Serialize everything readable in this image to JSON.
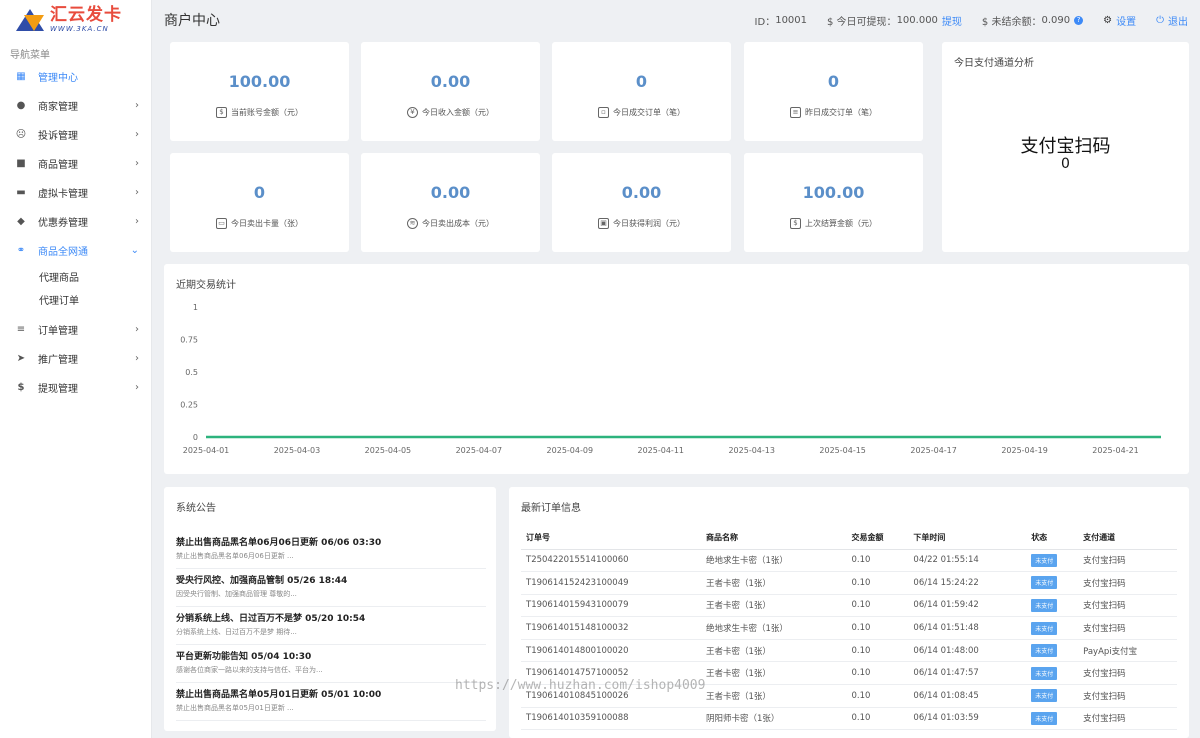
{
  "logo": {
    "text_cn": "汇云发卡",
    "text_en": "WWW.3KA.CN"
  },
  "sidebar": {
    "title": "导航菜单",
    "items": [
      {
        "label": "管理中心",
        "icon": "dashboard-icon"
      },
      {
        "label": "商家管理",
        "icon": "user-icon"
      },
      {
        "label": "投诉管理",
        "icon": "sad-face-icon"
      },
      {
        "label": "商品管理",
        "icon": "shopping-bag-icon"
      },
      {
        "label": "虚拟卡管理",
        "icon": "card-icon"
      },
      {
        "label": "优惠券管理",
        "icon": "tag-icon"
      },
      {
        "label": "商品全网通",
        "icon": "handshake-icon"
      },
      {
        "label": "订单管理",
        "icon": "list-icon"
      },
      {
        "label": "推广管理",
        "icon": "paper-plane-icon"
      },
      {
        "label": "提现管理",
        "icon": "dollar-icon"
      }
    ],
    "sub_items": [
      {
        "label": "代理商品"
      },
      {
        "label": "代理订单"
      }
    ]
  },
  "header": {
    "title": "商户中心",
    "id_label": "ID：",
    "id_value": "10001",
    "withdrawable_label": "$ 今日可提现：",
    "withdrawable_value": "100.000",
    "withdraw_link": "提现",
    "unsettled_label": "$ 未结余额：",
    "unsettled_value": "0.090",
    "settings_label": "设置",
    "logout_label": "退出"
  },
  "stats": [
    {
      "value": "100.00",
      "label": "当前账号金额（元）",
      "icon": "money-bag-icon"
    },
    {
      "value": "0.00",
      "label": "今日收入金额（元）",
      "icon": "yen-circle-icon"
    },
    {
      "value": "0",
      "label": "今日成交订单（笔）",
      "icon": "shopping-bag-icon"
    },
    {
      "value": "0",
      "label": "昨日成交订单（笔）",
      "icon": "document-icon"
    },
    {
      "value": "0",
      "label": "今日卖出卡量（张）",
      "icon": "card-icon"
    },
    {
      "value": "0.00",
      "label": "今日卖出成本（元）",
      "icon": "database-icon"
    },
    {
      "value": "0.00",
      "label": "今日获得利润（元）",
      "icon": "wallet-icon"
    },
    {
      "value": "100.00",
      "label": "上次结算金额（元）",
      "icon": "cash-icon"
    }
  ],
  "channel": {
    "title": "今日支付通道分析",
    "name": "支付宝扫码",
    "count": "0"
  },
  "chart_section": {
    "title": "近期交易统计"
  },
  "chart_data": {
    "type": "line",
    "x": [
      "2025-04-01",
      "2025-04-02",
      "2025-04-03",
      "2025-04-04",
      "2025-04-05",
      "2025-04-06",
      "2025-04-07",
      "2025-04-08",
      "2025-04-09",
      "2025-04-10",
      "2025-04-11",
      "2025-04-12",
      "2025-04-13",
      "2025-04-14",
      "2025-04-15",
      "2025-04-16",
      "2025-04-17",
      "2025-04-18",
      "2025-04-19",
      "2025-04-20",
      "2025-04-21",
      "2025-04-22"
    ],
    "x_tick_labels": [
      "2025-04-01",
      "2025-04-03",
      "2025-04-05",
      "2025-04-07",
      "2025-04-09",
      "2025-04-11",
      "2025-04-13",
      "2025-04-15",
      "2025-04-17",
      "2025-04-19",
      "2025-04-21"
    ],
    "series": [
      {
        "values": [
          0,
          0,
          0,
          0,
          0,
          0,
          0,
          0,
          0,
          0,
          0,
          0,
          0,
          0,
          0,
          0,
          0,
          0,
          0,
          0,
          0,
          0
        ],
        "color": "#2db37d"
      }
    ],
    "y_ticks": [
      "0",
      "0.25",
      "0.5",
      "0.75",
      "1"
    ],
    "ylim": [
      0,
      1
    ],
    "grid": false,
    "title": "",
    "xlabel": "",
    "ylabel": ""
  },
  "notices": {
    "title": "系统公告",
    "items": [
      {
        "title": "禁止出售商品黑名单06月06日更新 06/06 03:30",
        "desc": "禁止出售商品黑名单06月06日更新 ..."
      },
      {
        "title": "受央行风控、加强商品管制 05/26 18:44",
        "desc": "因受央行管制、加强商品管理 尊敬的..."
      },
      {
        "title": "分销系统上线、日过百万不是梦 05/20 10:54",
        "desc": "分销系统上线、日过百万不是梦 期待..."
      },
      {
        "title": "平台更新功能告知 05/04 10:30",
        "desc": "感谢各位商家一路以来的支持与信任、平台为..."
      },
      {
        "title": "禁止出售商品黑名单05月01日更新 05/01 10:00",
        "desc": "禁止出售商品黑名单05月01日更新 ..."
      }
    ]
  },
  "orders": {
    "title": "最新订单信息",
    "columns": [
      "订单号",
      "商品名称",
      "交易金额",
      "下单时间",
      "状态",
      "支付通道"
    ],
    "rows": [
      [
        "T250422015514100060",
        "绝地求生卡密（1张）",
        "0.10",
        "04/22 01:55:14",
        "未支付",
        "支付宝扫码"
      ],
      [
        "T190614152423100049",
        "王者卡密（1张）",
        "0.10",
        "06/14 15:24:22",
        "未支付",
        "支付宝扫码"
      ],
      [
        "T190614015943100079",
        "王者卡密（1张）",
        "0.10",
        "06/14 01:59:42",
        "未支付",
        "支付宝扫码"
      ],
      [
        "T190614015148100032",
        "绝地求生卡密（1张）",
        "0.10",
        "06/14 01:51:48",
        "未支付",
        "支付宝扫码"
      ],
      [
        "T190614014800100020",
        "王者卡密（1张）",
        "0.10",
        "06/14 01:48:00",
        "未支付",
        "PayApi支付宝"
      ],
      [
        "T190614014757100052",
        "王者卡密（1张）",
        "0.10",
        "06/14 01:47:57",
        "未支付",
        "支付宝扫码"
      ],
      [
        "T190614010845100026",
        "王者卡密（1张）",
        "0.10",
        "06/14 01:08:45",
        "未支付",
        "支付宝扫码"
      ],
      [
        "T190614010359100088",
        "阴阳师卡密（1张）",
        "0.10",
        "06/14 01:03:59",
        "未支付",
        "支付宝扫码"
      ]
    ]
  },
  "watermark": "https://www.huzhan.com/ishop4009",
  "colors": {
    "accent": "#3d8af7",
    "stat_value": "#5b8fc9",
    "line": "#2db37d",
    "badge": "#5aa4ef"
  }
}
